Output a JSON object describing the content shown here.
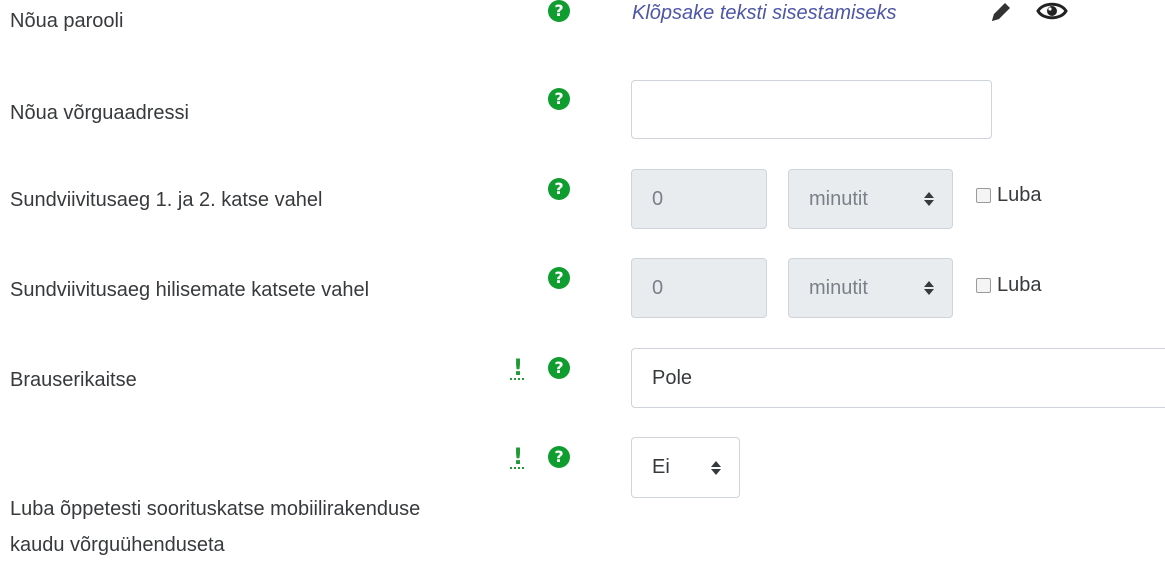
{
  "rows": {
    "password": {
      "label": "Nõua parooli",
      "inplace_text": "Klõpsake teksti sisestamiseks"
    },
    "network": {
      "label": "Nõua võrguaadressi",
      "value": ""
    },
    "delay1": {
      "label": "Sundviivitusaeg 1. ja 2. katse vahel",
      "value": "0",
      "unit": "minutit",
      "enable": "Luba"
    },
    "delay2": {
      "label": "Sundviivitusaeg hilisemate katsete vahel",
      "value": "0",
      "unit": "minutit",
      "enable": "Luba"
    },
    "browser": {
      "label": "Brauserikaitse",
      "value": "Pole"
    },
    "offline": {
      "label_line1": "Luba õppetesti soorituskatse mobiilirakenduse",
      "label_line2": "kaudu võrguühenduseta",
      "value": "Ei"
    }
  },
  "icons": {
    "help": "?",
    "advanced": "!"
  },
  "colors": {
    "help_green": "#0f9d2f",
    "link_purple": "#4d56a7"
  }
}
